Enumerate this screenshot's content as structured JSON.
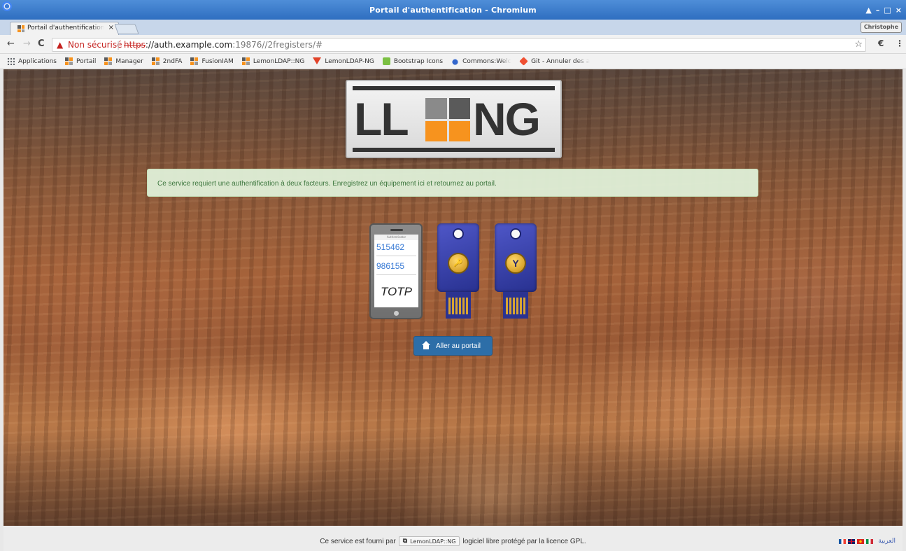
{
  "window": {
    "title": "Portail d'authentification - Chromium",
    "controls": {
      "close": "×"
    }
  },
  "tab": {
    "label": "Portail d'authentification",
    "close": "×"
  },
  "profile": {
    "name": "Christophe"
  },
  "toolbar": {
    "back": "←",
    "forward": "→",
    "reload": "C",
    "security_warning_icon": "▲",
    "security_label": "Non sécurisé",
    "url_scheme": "https",
    "url_host": "://auth.example.com",
    "url_rest": ":19876//2fregisters/#",
    "star": "☆",
    "menu": "⋮"
  },
  "bookmarks": [
    {
      "label": "Applications",
      "icon": "apps-grid-icon"
    },
    {
      "label": "Portail",
      "icon": "lemonldap-icon"
    },
    {
      "label": "Manager",
      "icon": "lemonldap-icon"
    },
    {
      "label": "2ndFA",
      "icon": "lemonldap-icon"
    },
    {
      "label": "FusionIAM",
      "icon": "lemonldap-icon"
    },
    {
      "label": "LemonLDAP::NG",
      "icon": "lemonldap-icon"
    },
    {
      "label": "LemonLDAP-NG",
      "icon": "gitlab-icon"
    },
    {
      "label": "Bootstrap Icons",
      "icon": "bootstrap-icon"
    },
    {
      "label": "Commons:Welcome",
      "icon": "commons-icon"
    },
    {
      "label": "Git - Annuler des a",
      "icon": "git-icon"
    }
  ],
  "logo": {
    "left": "LL",
    "right": "NG"
  },
  "alert": {
    "message": "Ce service requiert une authentification à deux facteurs. Enregistrez un équipement ici et retournez au portail."
  },
  "devices": {
    "phone_app_title": "Authenticator",
    "code1": "515462",
    "code2": "986155",
    "totp_label": "TOTP",
    "u2f_key_symbol": "🔑",
    "yubikey_symbol": "Y"
  },
  "portal_button": {
    "label": "Aller au portail"
  },
  "footer": {
    "text_before": "Ce service est fourni par",
    "link_label": "LemonLDAP::NG",
    "text_after": "logiciel libre protégé par la licence GPL.",
    "arabic": "العربية"
  },
  "colors": {
    "accent_blue": "#2d6ea8",
    "alert_bg": "#dff0d8",
    "alert_text": "#3c763d",
    "lemon_orange": "#f7931e",
    "lemon_gray": "#5a5a5a"
  }
}
